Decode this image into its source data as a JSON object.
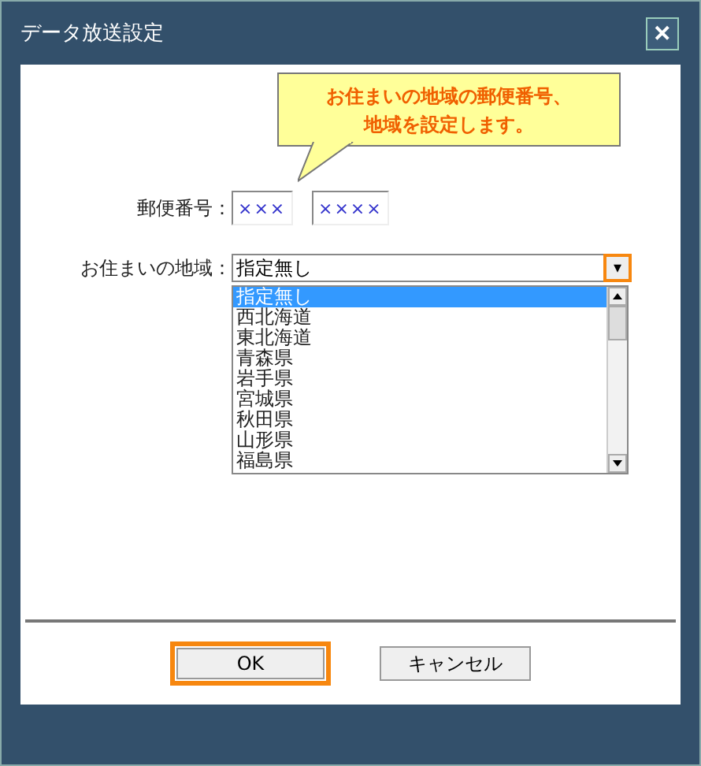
{
  "window": {
    "title": "データ放送設定",
    "close": "✕"
  },
  "callout": {
    "lines": [
      "お住まいの地域の郵便番号、",
      "地域を設定します。"
    ]
  },
  "postal": {
    "label": "郵便番号：",
    "fields": [
      {
        "value": "×××"
      },
      {
        "value": "××××"
      }
    ]
  },
  "region": {
    "label": "お住まいの地域：",
    "value": "指定無し",
    "highlighted": true,
    "arrow": "▾",
    "options": [
      {
        "label": "指定無し",
        "selected": true
      },
      {
        "label": "西北海道",
        "selected": false
      },
      {
        "label": "東北海道",
        "selected": false
      },
      {
        "label": "青森県",
        "selected": false
      },
      {
        "label": "岩手県",
        "selected": false
      },
      {
        "label": "宮城県",
        "selected": false
      },
      {
        "label": "秋田県",
        "selected": false
      },
      {
        "label": "山形県",
        "selected": false
      },
      {
        "label": "福島県",
        "selected": false
      }
    ]
  },
  "buttons": [
    {
      "label": "OK",
      "highlighted": true
    },
    {
      "label": "キャンセル",
      "highlighted": false
    }
  ]
}
